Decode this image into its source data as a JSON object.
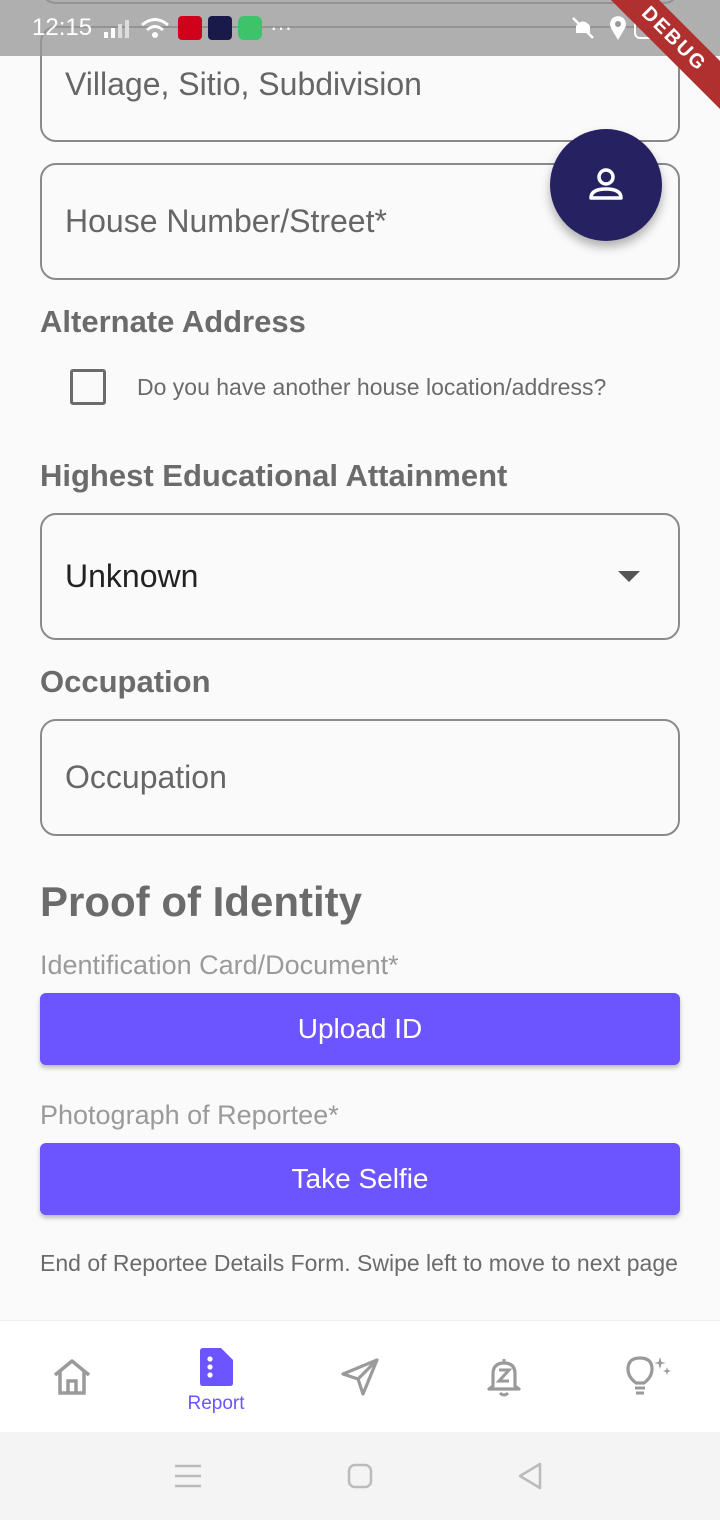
{
  "status_bar": {
    "time": "12:15",
    "debug_banner": "DEBUG"
  },
  "form": {
    "village_placeholder": "Village, Sitio, Subdivision",
    "house_placeholder": "House Number/Street*",
    "alternate_address_label": "Alternate Address",
    "alternate_address_question": "Do you have another house location/address?",
    "education_label": "Highest Educational Attainment",
    "education_value": "Unknown",
    "occupation_label": "Occupation",
    "occupation_placeholder": "Occupation",
    "proof_heading": "Proof of Identity",
    "id_label": "Identification Card/Document*",
    "upload_id_button": "Upload ID",
    "photo_label": "Photograph of Reportee*",
    "selfie_button": "Take Selfie",
    "end_note": "End of Reportee Details Form. Swipe left to move to next page"
  },
  "bottom_nav": {
    "active_label": "Report"
  },
  "colors": {
    "accent": "#6c54ff",
    "fab": "#262262"
  }
}
